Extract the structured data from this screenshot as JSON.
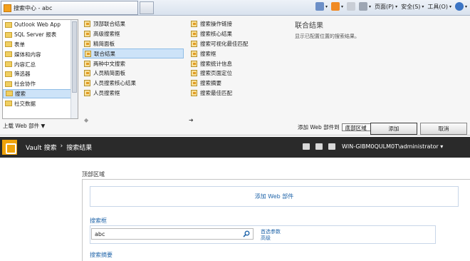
{
  "browser": {
    "tab_title": "搜索中心 - abc",
    "toolbar": {
      "page": "页面(P)",
      "safety": "安全(S)",
      "tools": "工具(O)"
    }
  },
  "gallery": {
    "categories": [
      "Outlook Web App",
      "SQL Server 报表",
      "表单",
      "媒体和内容",
      "内容汇总",
      "筛选器",
      "社会协作",
      "搜索",
      "社交数据"
    ],
    "selected_category": "搜索",
    "upload": "上载 Web 部件 ▼",
    "parts_col1": [
      "顶部联合结果",
      "高级搜索框",
      "精简面板",
      "联合结果",
      "两种中文搜索",
      "人员精简面板",
      "人员搜索核心结果",
      "人员搜索框"
    ],
    "parts_col2": [
      "搜索操作链接",
      "搜索核心结果",
      "搜索可视化最佳匹配",
      "搜索框",
      "搜索统计信息",
      "搜索页面定位",
      "搜索摘要",
      "搜索最佳匹配"
    ],
    "selected_part": "联合结果",
    "about": {
      "title": "联合结果",
      "description": "显示已配置位置的搜索结果。"
    },
    "add_to_label": "添加 Web 部件到",
    "zone_option": "底部区域",
    "add_button": "添加",
    "cancel_button": "取消"
  },
  "suite": {
    "site": "Vault 搜索",
    "sep": "›",
    "page": "搜索结果",
    "user": "WIN-GIBM0QULM0T\\administrator ▾"
  },
  "content": {
    "zone_label": "顶部区域",
    "add_web_part": "添加 Web 部件",
    "search_box_title": "搜索框",
    "search_value": "abc",
    "preferences": "首选参数",
    "advanced": "高级",
    "summary_title": "搜索摘要"
  },
  "colors": {
    "suite_bar": "#2a2a2a",
    "link": "#2266aa",
    "selection": "#cde3f8",
    "logo": "#f0a30a"
  }
}
